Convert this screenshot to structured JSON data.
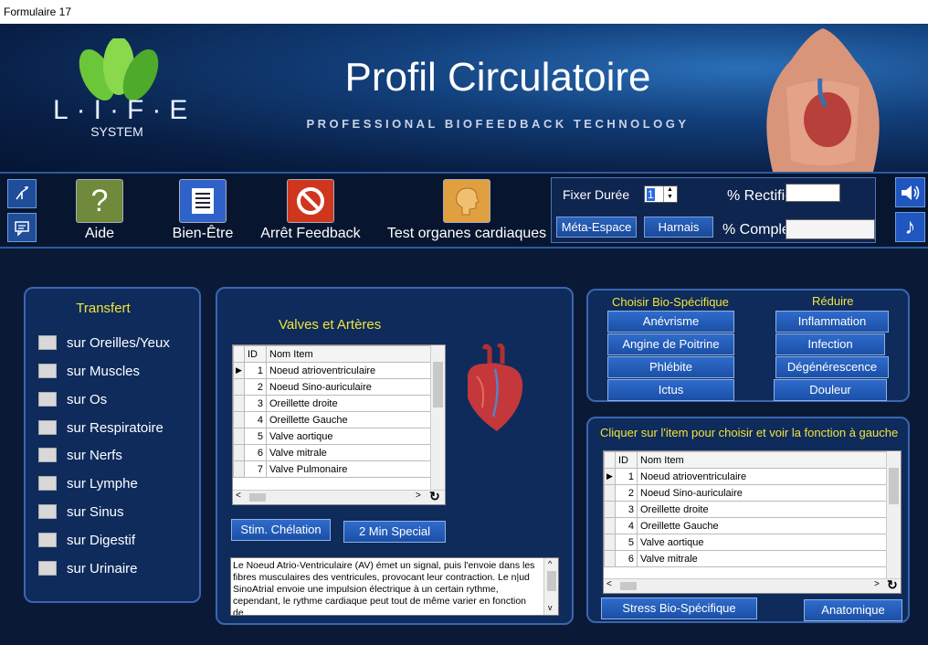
{
  "window": {
    "title": "Formulaire 17"
  },
  "banner": {
    "logo_text": "L·I·F·E",
    "logo_sub": "SYSTEM",
    "title": "Profil Circulatoire",
    "subtitle": "PROFESSIONAL BIOFEEDBACK TECHNOLOGY"
  },
  "toolbar": {
    "aide": "Aide",
    "bien_etre": "Bien-Être",
    "arret": "Arrêt Feedback",
    "test": "Test organes cardiaques"
  },
  "controls": {
    "fixer_duree": "Fixer Durée",
    "duree_value": "1",
    "meta_espace": "Méta-Espace",
    "harnais": "Harnais",
    "pct_rectifie": "% Rectifié",
    "pct_complet": "% Complet"
  },
  "transfert": {
    "title": "Transfert",
    "items": [
      "sur Oreilles/Yeux",
      "sur Muscles",
      "sur Os",
      "sur Respiratoire",
      "sur Nerfs",
      "sur Lymphe",
      "sur Sinus",
      "sur Digestif",
      "sur Urinaire"
    ]
  },
  "valves": {
    "title": "Valves et Artères",
    "col_id": "ID",
    "col_name": "Nom Item",
    "rows": [
      {
        "id": "1",
        "name": "Noeud atrioventriculaire"
      },
      {
        "id": "2",
        "name": "Noeud Sino-auriculaire"
      },
      {
        "id": "3",
        "name": "Oreillette droite"
      },
      {
        "id": "4",
        "name": "Oreillette Gauche"
      },
      {
        "id": "5",
        "name": "Valve aortique"
      },
      {
        "id": "6",
        "name": "Valve mitrale"
      },
      {
        "id": "7",
        "name": "Valve Pulmonaire"
      }
    ],
    "btn_stim": "Stim. Chélation",
    "btn_2min": "2 Min Special",
    "description": "Le Noeud Atrio-Ventriculaire (AV) émet un signal, puis l'envoie dans les fibres musculaires des ventricules, provocant leur contraction. Le n|ud SinoAtrial envoie une impulsion électrique à un certain rythme, cependant, le rythme cardiaque peut tout de même varier en fonction de"
  },
  "bio": {
    "left_title": "Choisir Bio-Spécifique",
    "right_title": "Réduire",
    "left": [
      "Anévrisme",
      "Angine de Poitrine",
      "Phlébite",
      "Ictus"
    ],
    "right": [
      "Inflammation",
      "Infection",
      "Dégénérescence",
      "Douleur"
    ]
  },
  "clicker": {
    "title": "Cliquer sur l'item pour choisir et voir la fonction à gauche",
    "col_id": "ID",
    "col_name": "Nom Item",
    "rows": [
      {
        "id": "1",
        "name": "Noeud atrioventriculaire"
      },
      {
        "id": "2",
        "name": "Noeud Sino-auriculaire"
      },
      {
        "id": "3",
        "name": "Oreillette droite"
      },
      {
        "id": "4",
        "name": "Oreillette Gauche"
      },
      {
        "id": "5",
        "name": "Valve aortique"
      },
      {
        "id": "6",
        "name": "Valve mitrale"
      }
    ],
    "btn_stress": "Stress Bio-Spécifique",
    "btn_anat": "Anatomique"
  }
}
